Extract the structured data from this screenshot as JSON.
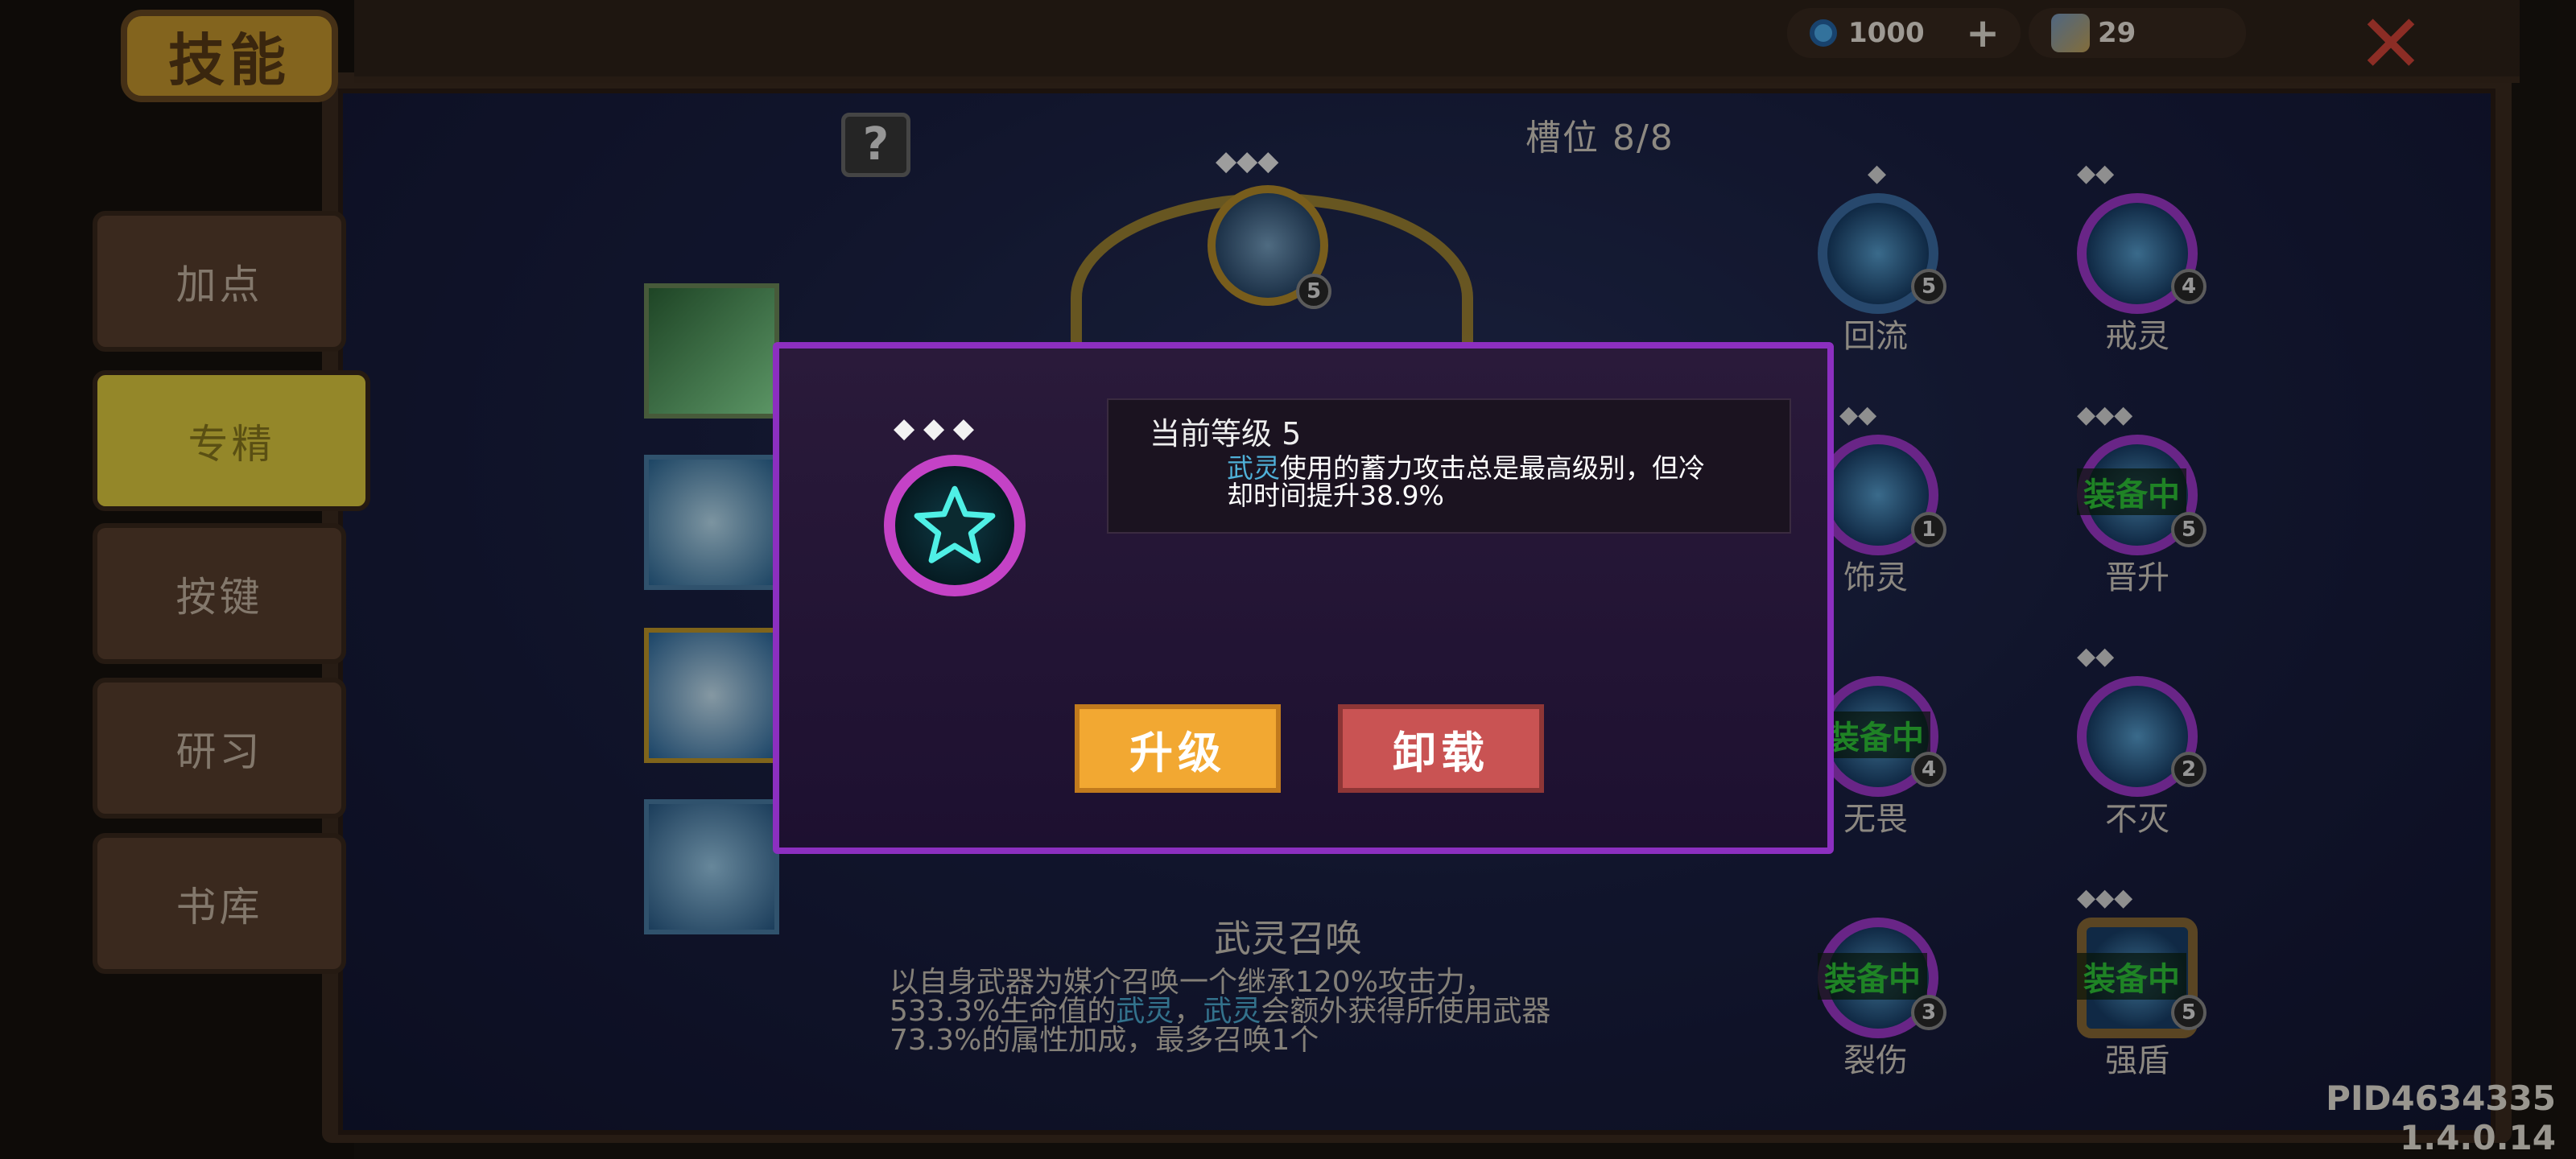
{
  "header": {
    "title": "技能",
    "currency_gems": "1000",
    "currency_plus": "+",
    "currency_fish": "29",
    "close": "✕"
  },
  "sidebar": {
    "items": [
      {
        "label": "加点"
      },
      {
        "label": "专精"
      },
      {
        "label": "按键"
      },
      {
        "label": "研习"
      },
      {
        "label": "书库"
      }
    ]
  },
  "main": {
    "help": "?",
    "slots": "槽位 8/8",
    "center_level": "5",
    "pips": "◆◆◆",
    "nodes": [
      {
        "label": "回流",
        "level": "5"
      },
      {
        "label": "戒灵",
        "level": "4"
      },
      {
        "label": "饰灵",
        "level": "1"
      },
      {
        "label": "晋升",
        "level": "5",
        "badge": "装备中"
      },
      {
        "label": "无畏",
        "level": "4",
        "badge": "装备中"
      },
      {
        "label": "不灭",
        "level": "2"
      },
      {
        "label": "裂伤",
        "level": "3",
        "badge": "装备中"
      },
      {
        "label": "强盾",
        "level": "5",
        "badge": "装备中"
      }
    ],
    "skill_name": "武灵召唤",
    "skill_desc": [
      {
        "t1": "以自身武器为媒介召唤一个继承120%攻击力，"
      },
      {
        "t1": "533.3%生命值的",
        "hl1": "武灵",
        "t2": "，",
        "hl2": "武灵",
        "t3": "会额外获得所使用武器"
      },
      {
        "t1": "73.3%的属性加成，最多召唤1个"
      }
    ]
  },
  "dialog": {
    "pips": "◆ ◆ ◆",
    "level_text": "当前等级 5",
    "desc_highlight": "武灵",
    "desc_line1": "使用的蓄力攻击总是最高级别，但冷",
    "desc_line2": "却时间提升38.9%",
    "upgrade_label": "升级",
    "unload_label": "卸载"
  },
  "footer": {
    "pid": "PID4634335 1.4.0.14"
  }
}
